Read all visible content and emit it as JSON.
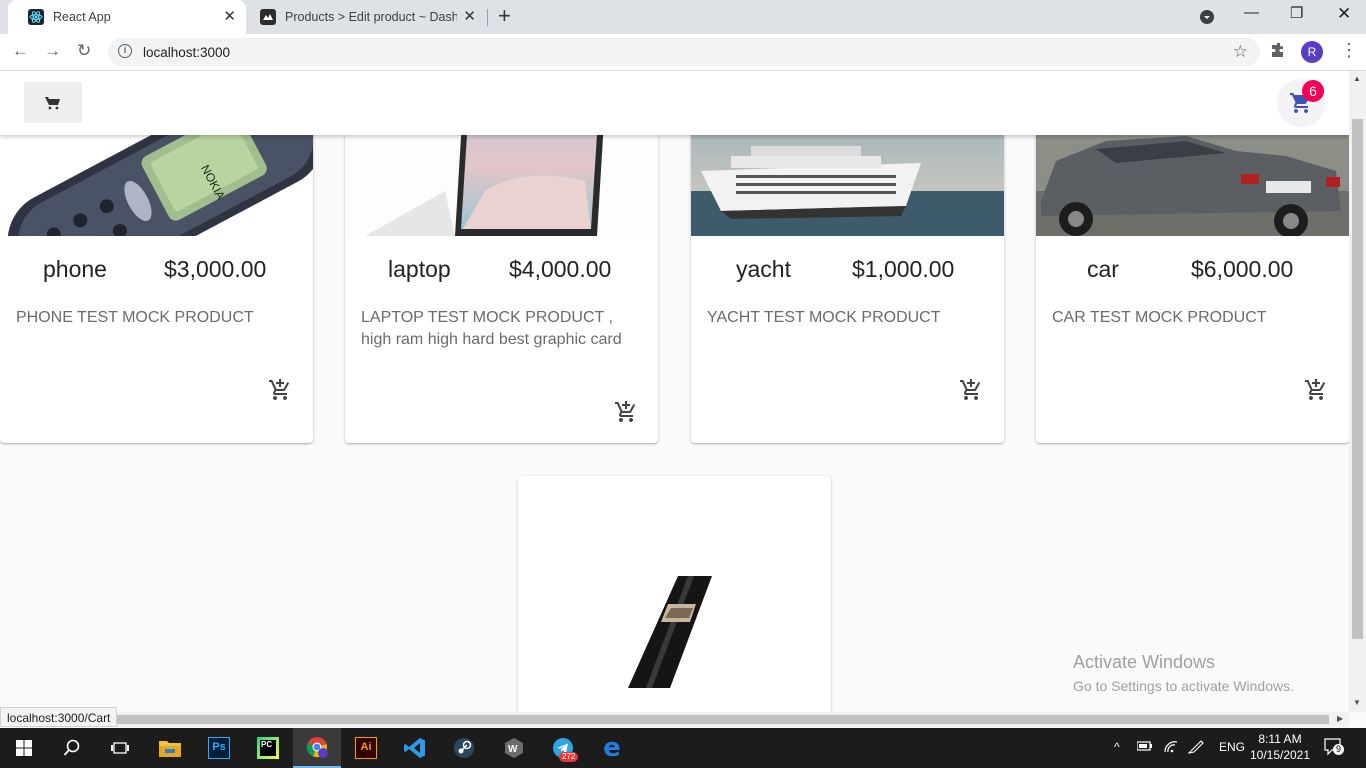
{
  "browser": {
    "tabs": [
      {
        "title": "React App",
        "active": true
      },
      {
        "title": "Products > Edit product ~ Dashb",
        "active": false
      }
    ],
    "url": "localhost:3000",
    "profile_initial": "R",
    "status_url": "localhost:3000/Cart"
  },
  "header": {
    "cart_count": "6"
  },
  "products": [
    {
      "title": "phone",
      "price": "$3,000.00",
      "description": "PHONE TEST MOCK PRODUCT",
      "extra": ""
    },
    {
      "title": "laptop",
      "price": "$4,000.00",
      "description": "LAPTOP TEST MOCK PRODUCT ,",
      "extra": "high ram high hard best graphic card"
    },
    {
      "title": "yacht",
      "price": "$1,000.00",
      "description": "YACHT TEST MOCK PRODUCT",
      "extra": ""
    },
    {
      "title": "car",
      "price": "$6,000.00",
      "description": "CAR TEST MOCK PRODUCT",
      "extra": ""
    }
  ],
  "watermark": {
    "line1": "Activate Windows",
    "line2": "Go to Settings to activate Windows."
  },
  "taskbar": {
    "language": "ENG",
    "time": "8:11 AM",
    "date": "10/15/2021",
    "telegram_badge": "272",
    "notification_count": "9"
  },
  "colors": {
    "primary": "#3f51b5",
    "badge": "#f50057",
    "appbar_bg": "#ffffff",
    "page_bg": "#fafafa"
  }
}
